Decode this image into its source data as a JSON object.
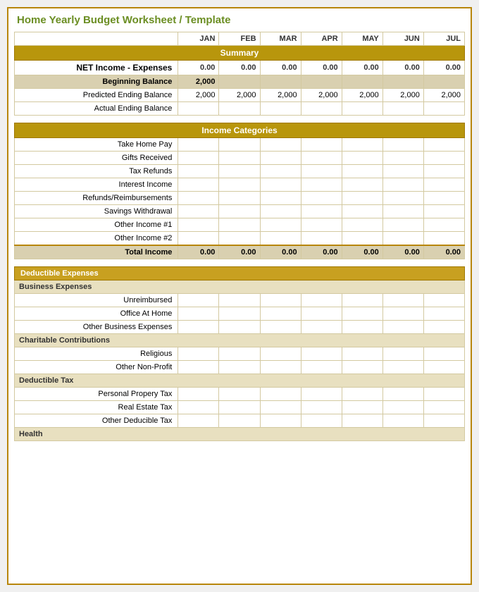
{
  "title": "Home Yearly Budget Worksheet / Template",
  "months": [
    "JAN",
    "FEB",
    "MAR",
    "APR",
    "MAY",
    "JUN",
    "JUL"
  ],
  "summary": {
    "section_label": "Summary",
    "net_income_label": "NET Income - Expenses",
    "net_income_values": [
      "0.00",
      "0.00",
      "0.00",
      "0.00",
      "0.00",
      "0.00",
      "0.00"
    ],
    "beginning_balance_label": "Beginning Balance",
    "beginning_balance_value": "2,000",
    "predicted_ending_label": "Predicted Ending Balance",
    "predicted_ending_values": [
      "2,000",
      "2,000",
      "2,000",
      "2,000",
      "2,000",
      "2,000",
      "2,000"
    ],
    "actual_ending_label": "Actual Ending Balance",
    "actual_ending_values": [
      "",
      "",
      "",
      "",
      "",
      "",
      ""
    ]
  },
  "income": {
    "section_label": "Income Categories",
    "rows": [
      "Take Home Pay",
      "Gifts Received",
      "Tax Refunds",
      "Interest Income",
      "Refunds/Reimbursements",
      "Savings Withdrawal",
      "Other Income #1",
      "Other Income #2"
    ],
    "total_label": "Total Income",
    "total_values": [
      "0.00",
      "0.00",
      "0.00",
      "0.00",
      "0.00",
      "0.00",
      "0.00"
    ]
  },
  "deductible": {
    "section_label": "Deductible Expenses",
    "subsections": [
      {
        "name": "Business Expenses",
        "rows": [
          "Unreimbursed",
          "Office At Home",
          "Other Business Expenses"
        ]
      },
      {
        "name": "Charitable Contributions",
        "rows": [
          "Religious",
          "Other Non-Profit"
        ]
      },
      {
        "name": "Deductible Tax",
        "rows": [
          "Personal Propery Tax",
          "Real Estate Tax",
          "Other Deducible Tax"
        ]
      },
      {
        "name": "Health",
        "rows": []
      }
    ]
  }
}
